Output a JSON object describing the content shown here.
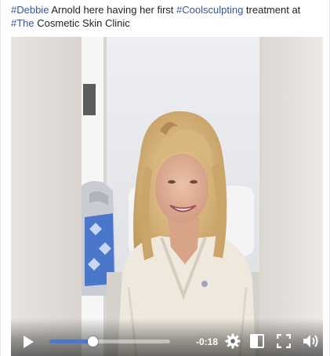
{
  "post": {
    "caption": {
      "tag_debbie": "#Debbie",
      "text_1": " Arnold here having her first ",
      "tag_coolsculpting": "#Coolsculpting",
      "text_2": " treatment at ",
      "tag_the": "#The",
      "text_3": " Cosmetic Skin Clinic"
    }
  },
  "player": {
    "time_remaining": "-0:18",
    "progress_fraction": 0.36,
    "icons": {
      "play": "play-icon",
      "settings": "gear-icon",
      "popout": "picture-in-picture-icon",
      "fullscreen": "fullscreen-icon",
      "volume": "speaker-volume-icon"
    },
    "accent_color": "#4a76d4"
  },
  "colors": {
    "hashtag": "#365899",
    "text": "#1d2129"
  }
}
